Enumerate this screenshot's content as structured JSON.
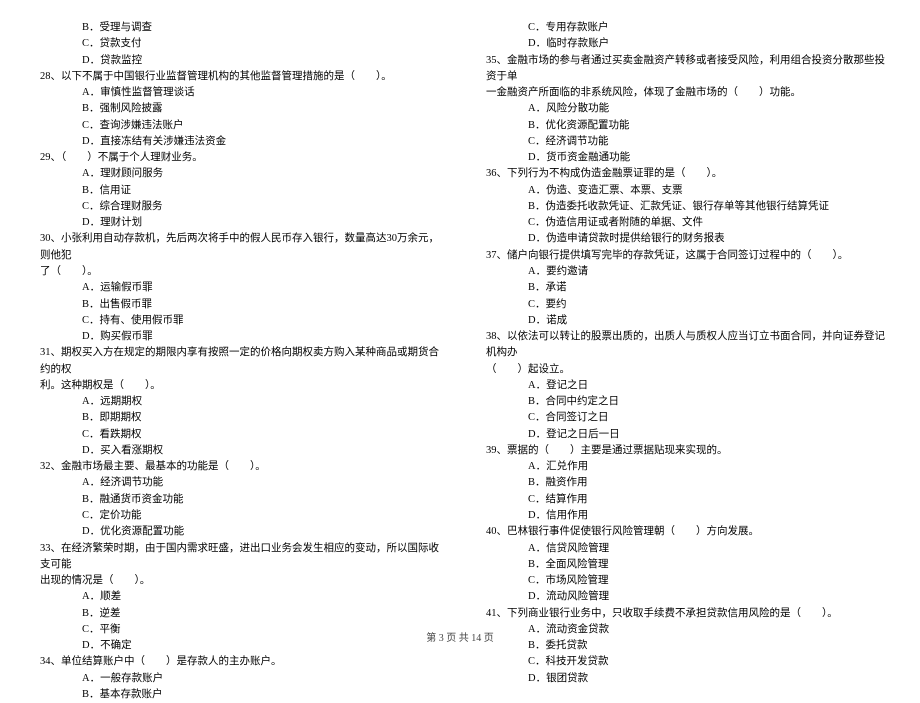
{
  "left": {
    "pre": [
      "B．受理与调查",
      "C．贷款支付",
      "D．贷款监控"
    ],
    "q28": {
      "stem": "28、以下不属于中国银行业监督管理机构的其他监督管理措施的是（　　）。",
      "opts": [
        "A．审慎性监督管理谈话",
        "B．强制风险披露",
        "C．查询涉嫌违法账户",
        "D．直接冻结有关涉嫌违法资金"
      ]
    },
    "q29": {
      "stem": "29、（　　）不属于个人理财业务。",
      "opts": [
        "A．理财顾问服务",
        "B．信用证",
        "C．综合理财服务",
        "D．理财计划"
      ]
    },
    "q30": {
      "stem": "30、小张利用自动存款机，先后两次将手中的假人民币存入银行，数量高达30万余元，则他犯",
      "cont": "了（　　）。",
      "opts": [
        "A．运输假币罪",
        "B．出售假币罪",
        "C．持有、使用假币罪",
        "D．购买假币罪"
      ]
    },
    "q31": {
      "stem": "31、期权买入方在规定的期限内享有按照一定的价格向期权卖方购入某种商品或期货合约的权",
      "cont": "利。这种期权是（　　）。",
      "opts": [
        "A．远期期权",
        "B．即期期权",
        "C．看跌期权",
        "D．买入看涨期权"
      ]
    },
    "q32": {
      "stem": "32、金融市场最主要、最基本的功能是（　　）。",
      "opts": [
        "A．经济调节功能",
        "B．融通货币资金功能",
        "C．定价功能",
        "D．优化资源配置功能"
      ]
    },
    "q33": {
      "stem": "33、在经济繁荣时期，由于国内需求旺盛，进出口业务会发生相应的变动，所以国际收支可能",
      "cont": "出现的情况是（　　）。",
      "opts": [
        "A．顺差",
        "B．逆差",
        "C．平衡",
        "D．不确定"
      ]
    },
    "q34": {
      "stem": "34、单位结算账户中（　　）是存款人的主办账户。",
      "opts": [
        "A．一般存款账户",
        "B．基本存款账户"
      ]
    }
  },
  "right": {
    "pre": [
      "C．专用存款账户",
      "D．临时存款账户"
    ],
    "q35": {
      "stem": "35、金融市场的参与者通过买卖金融资产转移或者接受风险，利用组合投资分散那些投资于单",
      "cont": "一金融资产所面临的非系统风险，体现了金融市场的（　　）功能。",
      "opts": [
        "A．风险分散功能",
        "B．优化资源配置功能",
        "C．经济调节功能",
        "D．货币资金融通功能"
      ]
    },
    "q36": {
      "stem": "36、下列行为不构成伪造金融票证罪的是（　　）。",
      "opts": [
        "A．伪造、变造汇票、本票、支票",
        "B．伪造委托收款凭证、汇款凭证、银行存单等其他银行结算凭证",
        "C．伪造信用证或者附随的单据、文件",
        "D．伪造申请贷款时提供给银行的财务报表"
      ]
    },
    "q37": {
      "stem": "37、储户向银行提供填写完毕的存款凭证，这属于合同签订过程中的（　　）。",
      "opts": [
        "A．要约邀请",
        "B．承诺",
        "C．要约",
        "D．诺成"
      ]
    },
    "q38": {
      "stem": "38、以依法可以转让的股票出质的，出质人与质权人应当订立书面合同，并向证券登记机构办",
      "cont": "（　　）起设立。",
      "opts": [
        "A．登记之日",
        "B．合同中约定之日",
        "C．合同签订之日",
        "D．登记之日后一日"
      ]
    },
    "q39": {
      "stem": "39、票据的（　　）主要是通过票据贴现来实现的。",
      "opts": [
        "A．汇兑作用",
        "B．融资作用",
        "C．结算作用",
        "D．信用作用"
      ]
    },
    "q40": {
      "stem": "40、巴林银行事件促使银行风险管理朝（　　）方向发展。",
      "opts": [
        "A．信贷风险管理",
        "B．全面风险管理",
        "C．市场风险管理",
        "D．流动风险管理"
      ]
    },
    "q41": {
      "stem": "41、下列商业银行业务中，只收取手续费不承担贷款信用风险的是（　　）。",
      "opts": [
        "A．流动资金贷款",
        "B．委托贷款",
        "C．科技开发贷款",
        "D．银团贷款"
      ]
    }
  },
  "footer": "第 3 页 共 14 页"
}
